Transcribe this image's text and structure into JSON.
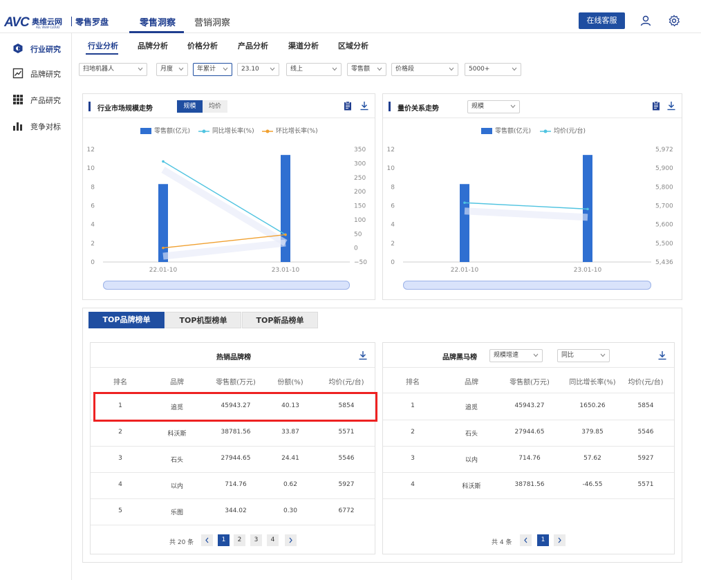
{
  "header": {
    "logo_text": "AVC",
    "logo_cn": "奥维云网",
    "logo_sub": "ALL VIEW CLOUD",
    "app_name": "零售罗盘",
    "tabs": [
      {
        "label": "零售洞察",
        "active": true
      },
      {
        "label": "营销洞察",
        "active": false
      }
    ],
    "service_button": "在线客服",
    "accent": "#1f4ea1"
  },
  "sidebar": {
    "items": [
      {
        "label": "行业研究",
        "icon": "industry-icon",
        "active": true
      },
      {
        "label": "品牌研究",
        "icon": "trend-chart-icon",
        "active": false
      },
      {
        "label": "产品研究",
        "icon": "grid-icon",
        "active": false
      },
      {
        "label": "竞争对标",
        "icon": "bar-chart-icon",
        "active": false
      }
    ]
  },
  "subtabs": [
    {
      "label": "行业分析",
      "active": true
    },
    {
      "label": "品牌分析",
      "active": false
    },
    {
      "label": "价格分析",
      "active": false
    },
    {
      "label": "产品分析",
      "active": false
    },
    {
      "label": "渠道分析",
      "active": false
    },
    {
      "label": "区域分析",
      "active": false
    }
  ],
  "filters": {
    "category": "扫地机器人",
    "period": "月度",
    "accumulation": "年累计",
    "date": "23.10",
    "channel": "线上",
    "metric": "零售额",
    "price_label": "价格段",
    "price_value": "5000+"
  },
  "chart_left": {
    "title": "行业市场规模走势",
    "toggle": [
      "规模",
      "均价"
    ],
    "legend": [
      "零售额(亿元)",
      "同比增长率(%)",
      "环比增长率(%)"
    ]
  },
  "chart_right": {
    "title": "量价关系走势",
    "select": "规模",
    "legend": [
      "零售额(亿元)",
      "均价(元/台)"
    ]
  },
  "chart_data": [
    {
      "type": "bar+line",
      "categories": [
        "22.01-10",
        "23.01-10"
      ],
      "series": [
        {
          "name": "零售额(亿元)",
          "type": "bar",
          "axis": "left",
          "values": [
            8.3,
            11.4
          ],
          "color": "#2f6fd1"
        },
        {
          "name": "同比增长率(%)",
          "type": "line",
          "axis": "right",
          "values": [
            307,
            47
          ],
          "color": "#4fc3e0"
        },
        {
          "name": "环比增长率(%)",
          "type": "line",
          "axis": "right",
          "values": [
            0,
            47
          ],
          "color": "#f0a030"
        }
      ],
      "ylim_left": [
        0,
        12
      ],
      "yticks_left": [
        "0",
        "2",
        "4",
        "6",
        "8",
        "10",
        "12"
      ],
      "ylim_right": [
        -50,
        350
      ],
      "yticks_right": [
        "−50",
        "0",
        "50",
        "100",
        "150",
        "200",
        "250",
        "300",
        "350"
      ]
    },
    {
      "type": "bar+line",
      "categories": [
        "22.01-10",
        "23.01-10"
      ],
      "series": [
        {
          "name": "零售额(亿元)",
          "type": "bar",
          "axis": "left",
          "values": [
            8.3,
            11.4
          ],
          "color": "#2f6fd1"
        },
        {
          "name": "均价(元/台)",
          "type": "line",
          "axis": "right",
          "values": [
            5718,
            5688
          ],
          "color": "#4fc3e0"
        }
      ],
      "ylim_left": [
        0,
        12
      ],
      "yticks_left": [
        "0",
        "2",
        "4",
        "6",
        "8",
        "10",
        "12"
      ],
      "ylim_right": [
        5436,
        5972
      ],
      "yticks_right": [
        "5,436",
        "5,500",
        "5,600",
        "5,700",
        "5,800",
        "5,900",
        "5,972"
      ]
    }
  ],
  "rank_tabs": [
    {
      "label": "TOP品牌榜单",
      "active": true
    },
    {
      "label": "TOP机型榜单",
      "active": false
    },
    {
      "label": "TOP新品榜单",
      "active": false
    }
  ],
  "hot_brands": {
    "title": "热销品牌榜",
    "columns": [
      "排名",
      "品牌",
      "零售额(万元)",
      "份额(%)",
      "均价(元/台)"
    ],
    "rows": [
      [
        "1",
        "追觅",
        "45943.27",
        "40.13",
        "5854"
      ],
      [
        "2",
        "科沃斯",
        "38781.56",
        "33.87",
        "5571"
      ],
      [
        "3",
        "石头",
        "27944.65",
        "24.41",
        "5546"
      ],
      [
        "4",
        "以内",
        "714.76",
        "0.62",
        "5927"
      ],
      [
        "5",
        "乐图",
        "344.02",
        "0.30",
        "6772"
      ]
    ],
    "total": "共 20 条",
    "pages": [
      "1",
      "2",
      "3",
      "4"
    ],
    "current_page": "1"
  },
  "dark_horse": {
    "title": "品牌黑马榜",
    "select1": "规模增速",
    "select2": "同比",
    "columns": [
      "排名",
      "品牌",
      "零售额(万元)",
      "同比增长率(%)",
      "均价(元/台)"
    ],
    "rows": [
      [
        "1",
        "追觅",
        "45943.27",
        "1650.26",
        "5854"
      ],
      [
        "2",
        "石头",
        "27944.65",
        "379.85",
        "5546"
      ],
      [
        "3",
        "以内",
        "714.76",
        "57.62",
        "5927"
      ],
      [
        "4",
        "科沃斯",
        "38781.56",
        "-46.55",
        "5571"
      ]
    ],
    "total": "共 4 条",
    "pages": [
      "1"
    ],
    "current_page": "1"
  }
}
